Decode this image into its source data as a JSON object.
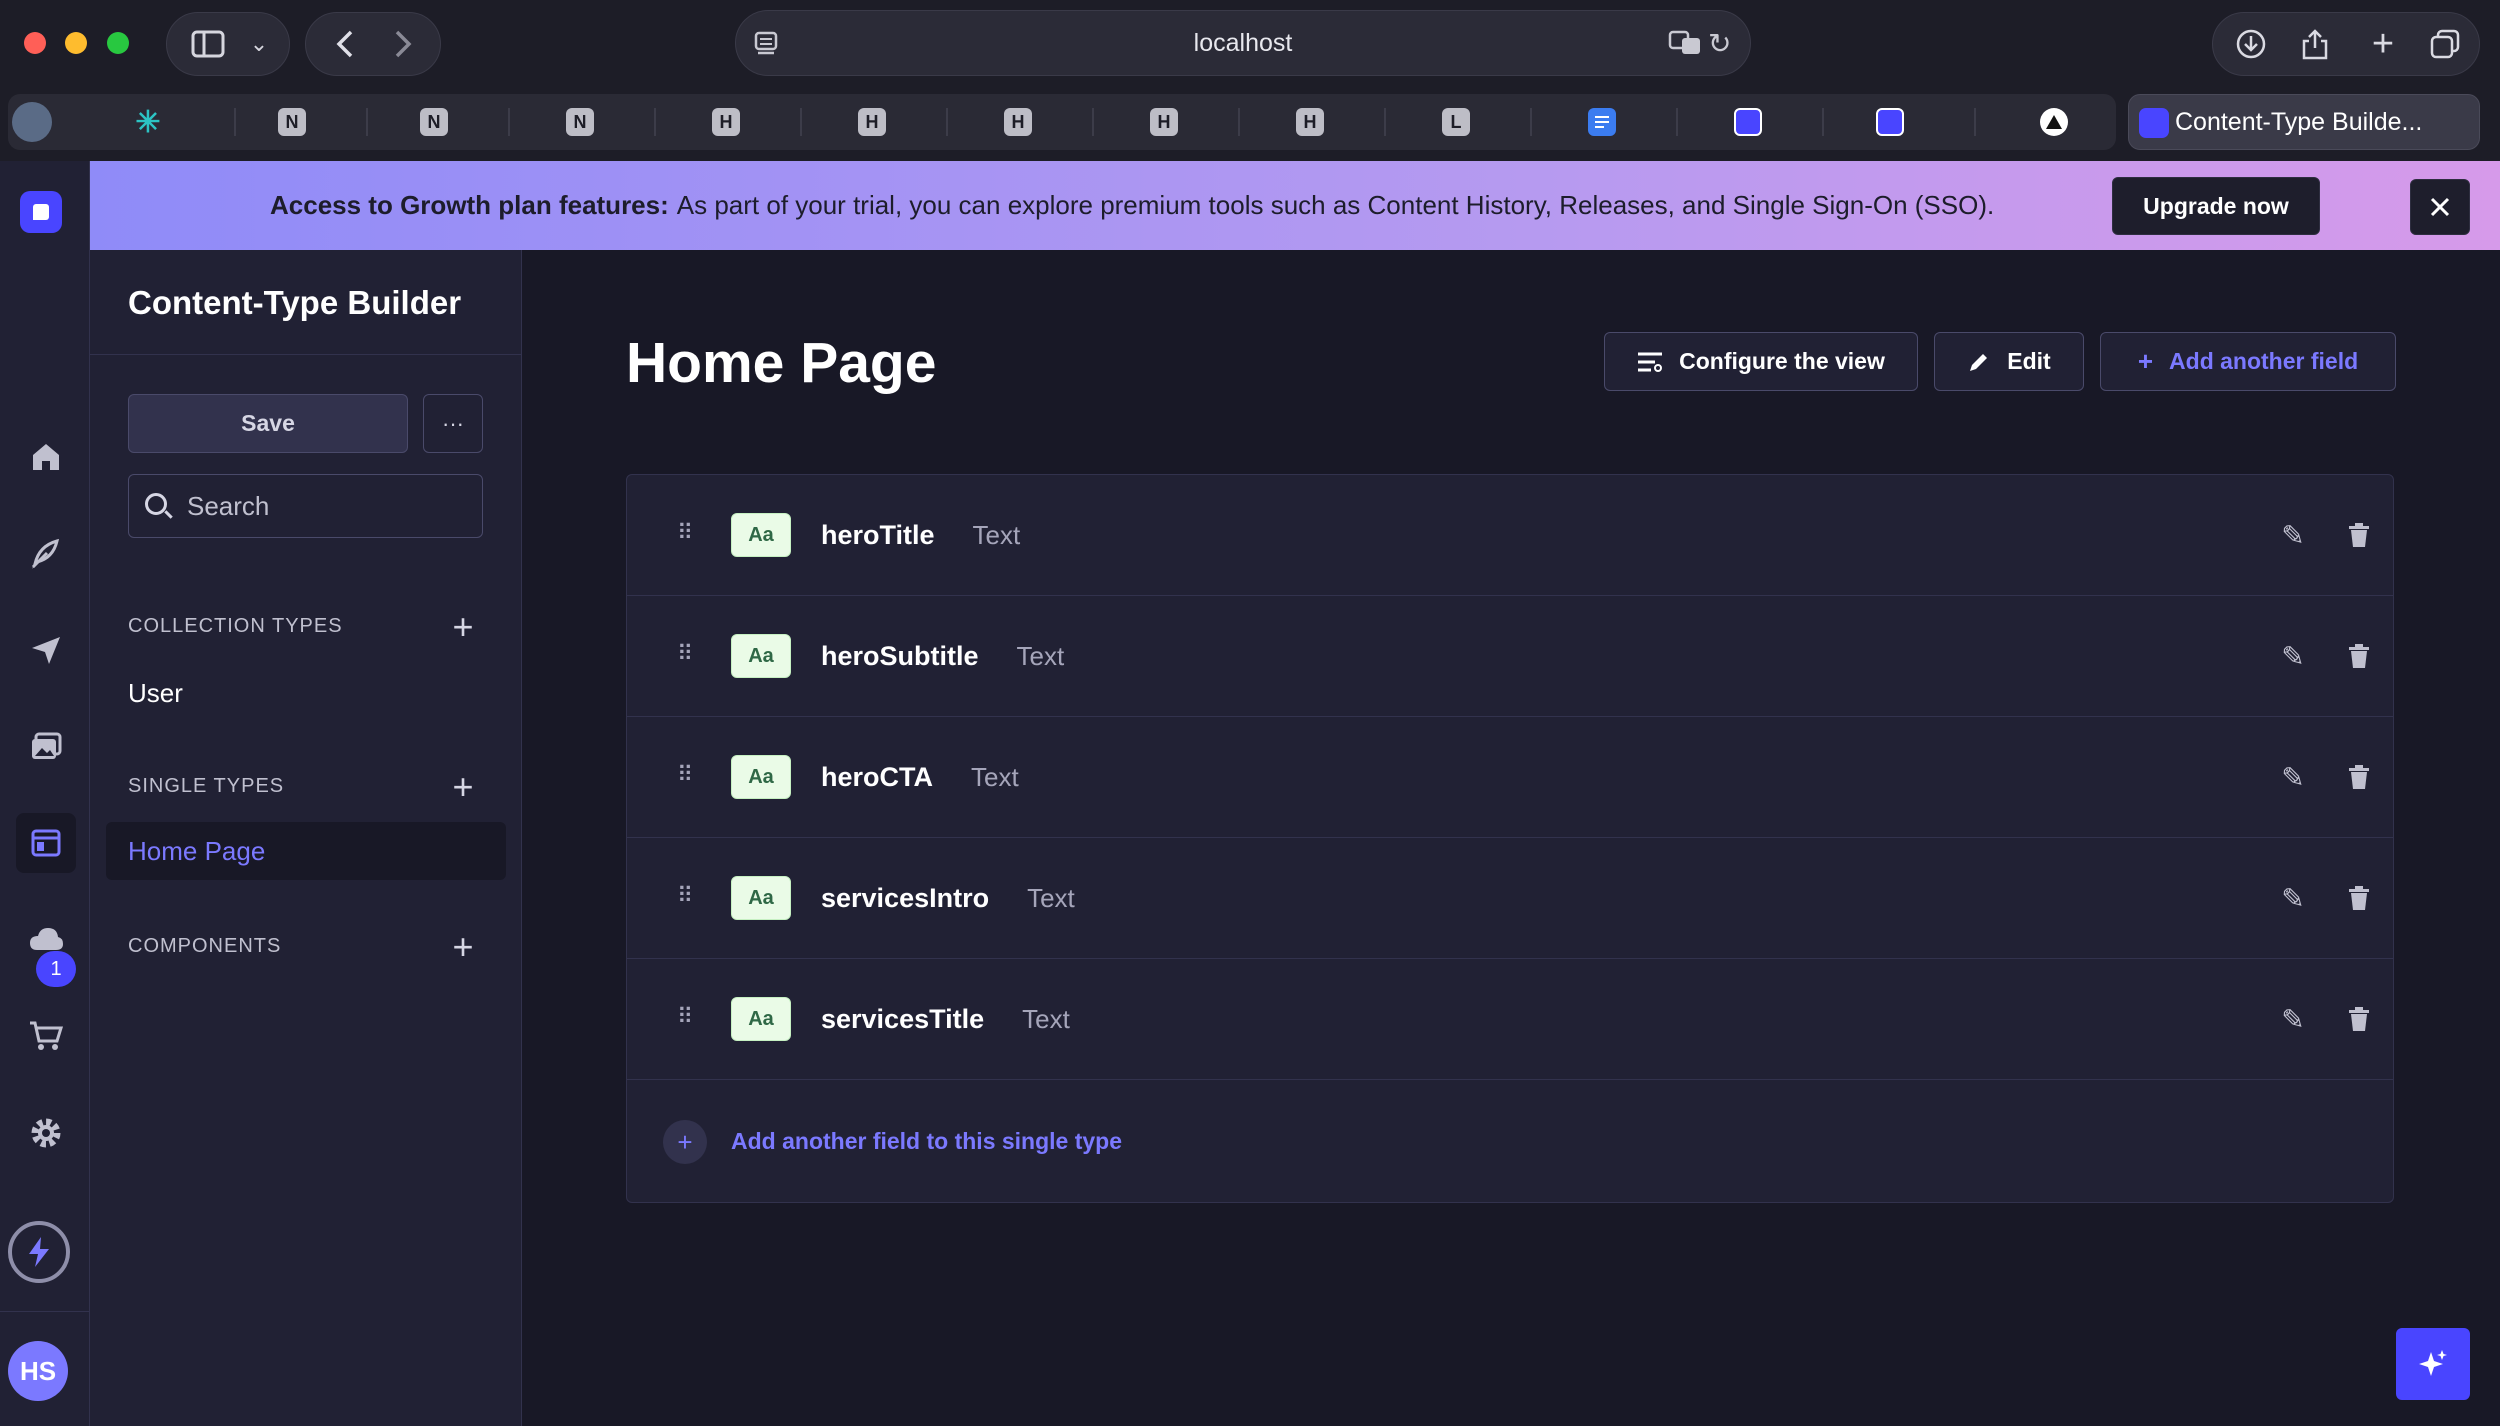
{
  "browser": {
    "address": "localhost",
    "active_tab_title": "Content-Type Builde...",
    "tab_letters": [
      "N",
      "N",
      "N",
      "H",
      "H",
      "H",
      "H",
      "H",
      "L"
    ]
  },
  "banner": {
    "strong": "Access to Growth plan features:",
    "text": "As part of your trial, you can explore premium tools such as Content History, Releases, and Single Sign-On (SSO).",
    "upgrade_label": "Upgrade now"
  },
  "rail": {
    "notification_count": "1",
    "avatar_initials": "HS"
  },
  "subnav": {
    "title": "Content-Type Builder",
    "save_label": "Save",
    "more_label": "···",
    "search_placeholder": "Search",
    "collection_types_label": "COLLECTION TYPES",
    "collection_items": [
      "User"
    ],
    "single_types_label": "SINGLE TYPES",
    "single_items": [
      "Home Page"
    ],
    "components_label": "COMPONENTS"
  },
  "main": {
    "title": "Home Page",
    "configure_label": "Configure the view",
    "edit_label": "Edit",
    "add_field_label": "Add another field",
    "type_icon_text": "Aa",
    "fields": [
      {
        "name": "heroTitle",
        "type": "Text"
      },
      {
        "name": "heroSubtitle",
        "type": "Text"
      },
      {
        "name": "heroCTA",
        "type": "Text"
      },
      {
        "name": "servicesIntro",
        "type": "Text"
      },
      {
        "name": "servicesTitle",
        "type": "Text"
      }
    ],
    "add_to_single_label": "Add another field to this single type"
  },
  "colors": {
    "primary": "#4945ff",
    "primary_light": "#7b79ff",
    "background": "#181826",
    "surface": "#212134"
  }
}
